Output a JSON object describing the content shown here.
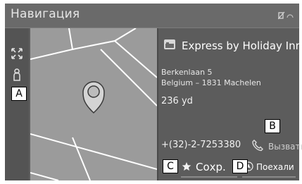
{
  "header": {
    "title": "Навигация"
  },
  "poi": {
    "name": "Express by Holiday Inn–B",
    "address_line1": "Berkenlaan 5",
    "address_line2": "Belgium – 1831 Machelen",
    "distance": "236 yd",
    "phone": "+(32)-2-7253380"
  },
  "actions": {
    "call_label": "Вызвать",
    "save_label": "Сохр.",
    "go_label": "Поехали"
  },
  "callouts": {
    "a": "A",
    "b": "B",
    "c": "C",
    "d": "D"
  },
  "icons": [
    "zoom-icon",
    "person-pin-icon",
    "hotel-icon",
    "phone-icon",
    "star-icon",
    "navigate-icon",
    "signal-status-icon"
  ]
}
